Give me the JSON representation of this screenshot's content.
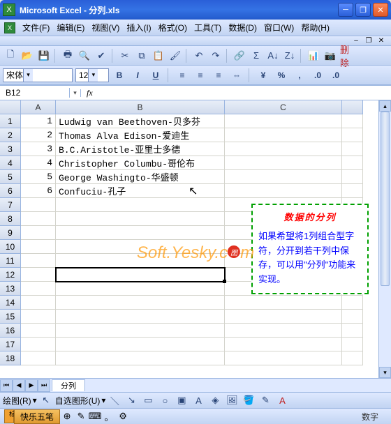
{
  "titlebar": {
    "app": "Microsoft Excel",
    "sep": " - ",
    "file": "分列.xls"
  },
  "menubar": {
    "items": [
      "文件(F)",
      "编辑(E)",
      "视图(V)",
      "插入(I)",
      "格式(O)",
      "工具(T)",
      "数据(D)",
      "窗口(W)",
      "帮助(H)"
    ]
  },
  "format": {
    "font": "宋体",
    "size": "12"
  },
  "namebox": "B12",
  "fx_label": "fx",
  "columns": [
    "A",
    "B",
    "C"
  ],
  "rows": [
    {
      "n": "1",
      "a": "1",
      "b": "Ludwig van Beethoven-贝多芬",
      "c": ""
    },
    {
      "n": "2",
      "a": "2",
      "b": "Thomas Alva Edison-爱迪生",
      "c": ""
    },
    {
      "n": "3",
      "a": "3",
      "b": "B.C.Aristotle-亚里士多德",
      "c": ""
    },
    {
      "n": "4",
      "a": "4",
      "b": "Christopher Columbu-哥伦布",
      "c": ""
    },
    {
      "n": "5",
      "a": "5",
      "b": "George Washingto-华盛顿",
      "c": ""
    },
    {
      "n": "6",
      "a": "6",
      "b": "Confuciu-孔子",
      "c": ""
    },
    {
      "n": "7",
      "a": "",
      "b": "",
      "c": ""
    },
    {
      "n": "8",
      "a": "",
      "b": "",
      "c": ""
    },
    {
      "n": "9",
      "a": "",
      "b": "",
      "c": ""
    },
    {
      "n": "10",
      "a": "",
      "b": "",
      "c": ""
    },
    {
      "n": "11",
      "a": "",
      "b": "",
      "c": ""
    },
    {
      "n": "12",
      "a": "",
      "b": "",
      "c": ""
    },
    {
      "n": "13",
      "a": "",
      "b": "",
      "c": ""
    },
    {
      "n": "14",
      "a": "",
      "b": "",
      "c": ""
    },
    {
      "n": "15",
      "a": "",
      "b": "",
      "c": ""
    },
    {
      "n": "16",
      "a": "",
      "b": "",
      "c": ""
    },
    {
      "n": "17",
      "a": "",
      "b": "",
      "c": ""
    },
    {
      "n": "18",
      "a": "",
      "b": "",
      "c": ""
    }
  ],
  "selected_cell": "B12",
  "callout": {
    "title": "数据的分列",
    "body": "如果希望将1列组合型字符，分开到若干列中保存，可以用\"分列\"功能来实现。"
  },
  "watermark": {
    "part1": "Soft.Yesky.c",
    "tu": "图",
    "part2": "m"
  },
  "sheet_tab": "分列",
  "drawing_label": "绘图(R)",
  "autoshape_label": "自选图形(U)",
  "ime_name": "快乐五笔",
  "status_right": "数字"
}
